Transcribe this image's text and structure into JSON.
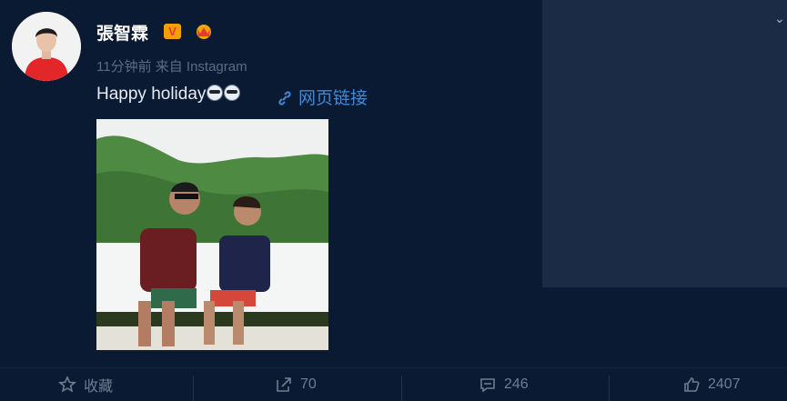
{
  "user": {
    "name": "張智霖",
    "verified_badge": "V",
    "crown_icon": "crown-icon"
  },
  "post": {
    "meta": "11分钟前 来自 Instagram",
    "text": "Happy holiday",
    "link_label": "网页链接"
  },
  "actions": {
    "favorite_label": "收藏",
    "repost_count": "70",
    "comment_count": "246",
    "like_count": "2407"
  },
  "colors": {
    "background": "#0b1a33",
    "panel": "#1c2b45",
    "link": "#3f89d6",
    "badge": "#f59f00"
  }
}
